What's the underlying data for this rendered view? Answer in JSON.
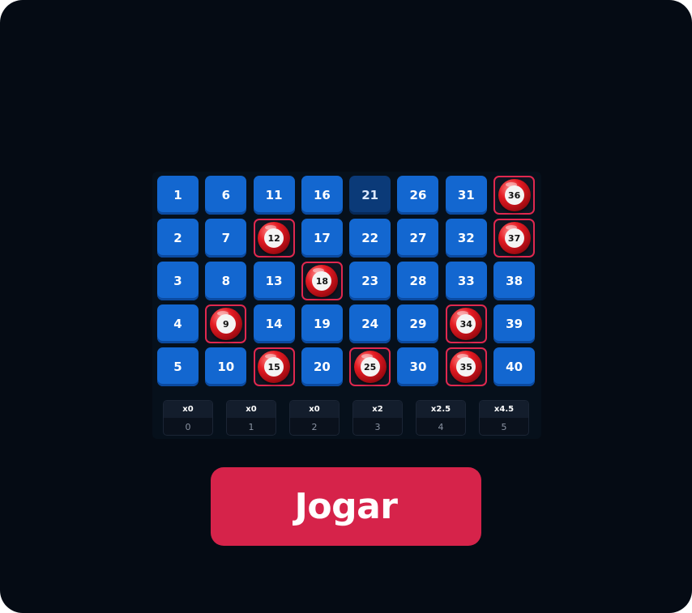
{
  "board": {
    "cells": [
      {
        "number": "1",
        "state": "normal"
      },
      {
        "number": "2",
        "state": "normal"
      },
      {
        "number": "3",
        "state": "normal"
      },
      {
        "number": "4",
        "state": "normal"
      },
      {
        "number": "5",
        "state": "normal"
      },
      {
        "number": "6",
        "state": "normal"
      },
      {
        "number": "7",
        "state": "normal"
      },
      {
        "number": "8",
        "state": "normal"
      },
      {
        "number": "9",
        "state": "drawn"
      },
      {
        "number": "10",
        "state": "normal"
      },
      {
        "number": "11",
        "state": "normal"
      },
      {
        "number": "12",
        "state": "drawn"
      },
      {
        "number": "13",
        "state": "normal"
      },
      {
        "number": "14",
        "state": "normal"
      },
      {
        "number": "15",
        "state": "drawn"
      },
      {
        "number": "16",
        "state": "normal"
      },
      {
        "number": "17",
        "state": "normal"
      },
      {
        "number": "18",
        "state": "drawn"
      },
      {
        "number": "19",
        "state": "normal"
      },
      {
        "number": "20",
        "state": "normal"
      },
      {
        "number": "21",
        "state": "dark"
      },
      {
        "number": "22",
        "state": "normal"
      },
      {
        "number": "23",
        "state": "normal"
      },
      {
        "number": "24",
        "state": "normal"
      },
      {
        "number": "25",
        "state": "drawn"
      },
      {
        "number": "26",
        "state": "normal"
      },
      {
        "number": "27",
        "state": "normal"
      },
      {
        "number": "28",
        "state": "normal"
      },
      {
        "number": "29",
        "state": "normal"
      },
      {
        "number": "30",
        "state": "normal"
      },
      {
        "number": "31",
        "state": "normal"
      },
      {
        "number": "32",
        "state": "normal"
      },
      {
        "number": "33",
        "state": "normal"
      },
      {
        "number": "34",
        "state": "drawn"
      },
      {
        "number": "35",
        "state": "drawn"
      },
      {
        "number": "36",
        "state": "drawn"
      },
      {
        "number": "37",
        "state": "drawn"
      },
      {
        "number": "38",
        "state": "normal"
      },
      {
        "number": "39",
        "state": "normal"
      },
      {
        "number": "40",
        "state": "normal"
      }
    ]
  },
  "paytable": [
    {
      "multiplier": "x0",
      "hits": "0"
    },
    {
      "multiplier": "x0",
      "hits": "1"
    },
    {
      "multiplier": "x0",
      "hits": "2"
    },
    {
      "multiplier": "x2",
      "hits": "3"
    },
    {
      "multiplier": "x2.5",
      "hits": "4"
    },
    {
      "multiplier": "x4.5",
      "hits": "5"
    }
  ],
  "play_button": {
    "label": "Jogar"
  },
  "colors": {
    "background": "#050b14",
    "cell": "#1367d0",
    "cell_dark": "#0b3a78",
    "ball": "#e41b23",
    "highlight_border": "#e0284f",
    "button": "#d6234a"
  }
}
